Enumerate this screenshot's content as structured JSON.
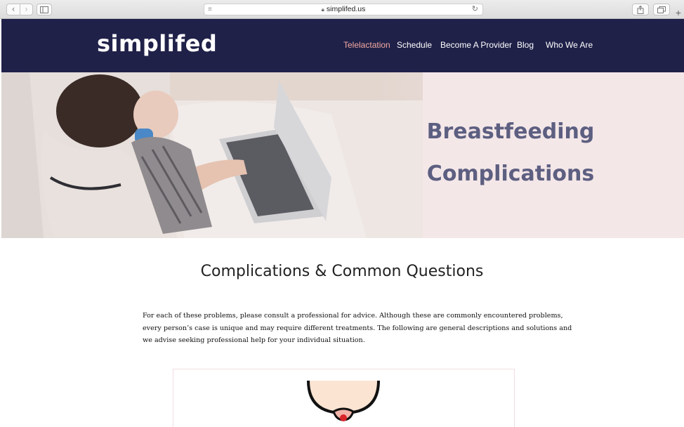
{
  "browser": {
    "url": "simplifed.us",
    "icons": {
      "back": "chevron-left-icon",
      "forward": "chevron-right-icon",
      "sidebar": "sidebar-icon",
      "reader": "reader-icon",
      "lock": "lock-icon",
      "reload": "reload-icon",
      "share": "share-icon",
      "tabs": "tabs-icon",
      "new_tab": "plus-icon"
    }
  },
  "header": {
    "logo": "simplifed",
    "nav": [
      {
        "label": "Telelactation",
        "active": true
      },
      {
        "label": "Schedule",
        "active": false
      },
      {
        "label": "Become A Provider",
        "active": false
      },
      {
        "label": "Blog",
        "active": false
      },
      {
        "label": "Who We Are",
        "active": false
      }
    ]
  },
  "hero": {
    "title_line1": "Breastfeeding",
    "title_line2": "Complications"
  },
  "main": {
    "section_title": "Complications & Common Questions",
    "intro_lines": [
      "For each of these problems, please consult a professional for advice.  Although these are commonly encountered problems,",
      "every person’s case is unique and may require different treatments.  The following are general descriptions and solutions and",
      "we advise seeking professional help for your individual situation."
    ]
  },
  "colors": {
    "header_bg": "#1f2149",
    "nav_active": "#f3a9a0",
    "hero_bg": "#f4e7e8",
    "hero_title": "#5d5f81"
  }
}
